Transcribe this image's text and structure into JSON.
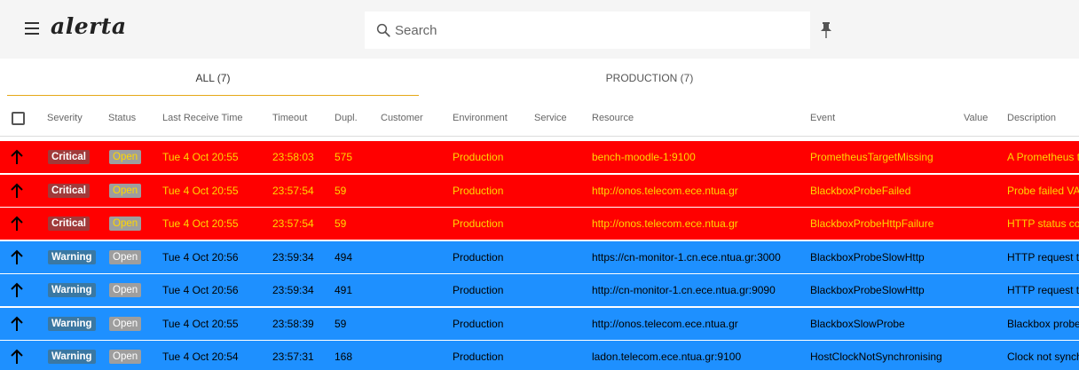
{
  "app": {
    "title": "alerta"
  },
  "search": {
    "placeholder": "Search",
    "value": ""
  },
  "tabs": [
    {
      "label": "ALL (7)",
      "active": true
    },
    {
      "label": "PRODUCTION (7)",
      "active": false
    }
  ],
  "columns": {
    "severity": "Severity",
    "status": "Status",
    "last_receive_time": "Last Receive Time",
    "timeout": "Timeout",
    "dupl": "Dupl.",
    "customer": "Customer",
    "environment": "Environment",
    "service": "Service",
    "resource": "Resource",
    "event": "Event",
    "value": "Value",
    "description": "Description"
  },
  "colors": {
    "critical_bg": "#ff0000",
    "critical_text": "#ffd700",
    "warning_bg": "#1e90ff",
    "warning_text": "#000000",
    "tab_indicator": "#e6a817"
  },
  "icons": {
    "menu": "hamburger-icon",
    "search": "search-icon",
    "pin": "pin-icon",
    "trend": "arrow-up-icon"
  },
  "alerts": [
    {
      "severity": "Critical",
      "status": "Open",
      "last_receive_time": "Tue 4 Oct 20:55",
      "timeout": "23:58:03",
      "dupl": "575",
      "customer": "",
      "environment": "Production",
      "service": "",
      "resource": "bench-moodle-1:9100",
      "event": "PrometheusTargetMissing",
      "value": "",
      "description": "A Prometheus t"
    },
    {
      "severity": "Critical",
      "status": "Open",
      "last_receive_time": "Tue 4 Oct 20:55",
      "timeout": "23:57:54",
      "dupl": "59",
      "customer": "",
      "environment": "Production",
      "service": "",
      "resource": "http://onos.telecom.ece.ntua.gr",
      "event": "BlackboxProbeFailed",
      "value": "",
      "description": "Probe failed VA"
    },
    {
      "severity": "Critical",
      "status": "Open",
      "last_receive_time": "Tue 4 Oct 20:55",
      "timeout": "23:57:54",
      "dupl": "59",
      "customer": "",
      "environment": "Production",
      "service": "",
      "resource": "http://onos.telecom.ece.ntua.gr",
      "event": "BlackboxProbeHttpFailure",
      "value": "",
      "description": "HTTP status co"
    },
    {
      "severity": "Warning",
      "status": "Open",
      "last_receive_time": "Tue 4 Oct 20:56",
      "timeout": "23:59:34",
      "dupl": "494",
      "customer": "",
      "environment": "Production",
      "service": "",
      "resource": "https://cn-monitor-1.cn.ece.ntua.gr:3000",
      "event": "BlackboxProbeSlowHttp",
      "value": "",
      "description": "HTTP request t"
    },
    {
      "severity": "Warning",
      "status": "Open",
      "last_receive_time": "Tue 4 Oct 20:56",
      "timeout": "23:59:34",
      "dupl": "491",
      "customer": "",
      "environment": "Production",
      "service": "",
      "resource": "http://cn-monitor-1.cn.ece.ntua.gr:9090",
      "event": "BlackboxProbeSlowHttp",
      "value": "",
      "description": "HTTP request t"
    },
    {
      "severity": "Warning",
      "status": "Open",
      "last_receive_time": "Tue 4 Oct 20:55",
      "timeout": "23:58:39",
      "dupl": "59",
      "customer": "",
      "environment": "Production",
      "service": "",
      "resource": "http://onos.telecom.ece.ntua.gr",
      "event": "BlackboxSlowProbe",
      "value": "",
      "description": "Blackbox probe"
    },
    {
      "severity": "Warning",
      "status": "Open",
      "last_receive_time": "Tue 4 Oct 20:54",
      "timeout": "23:57:31",
      "dupl": "168",
      "customer": "",
      "environment": "Production",
      "service": "",
      "resource": "ladon.telecom.ece.ntua.gr:9100",
      "event": "HostClockNotSynchronising",
      "value": "",
      "description": "Clock not synch"
    }
  ]
}
